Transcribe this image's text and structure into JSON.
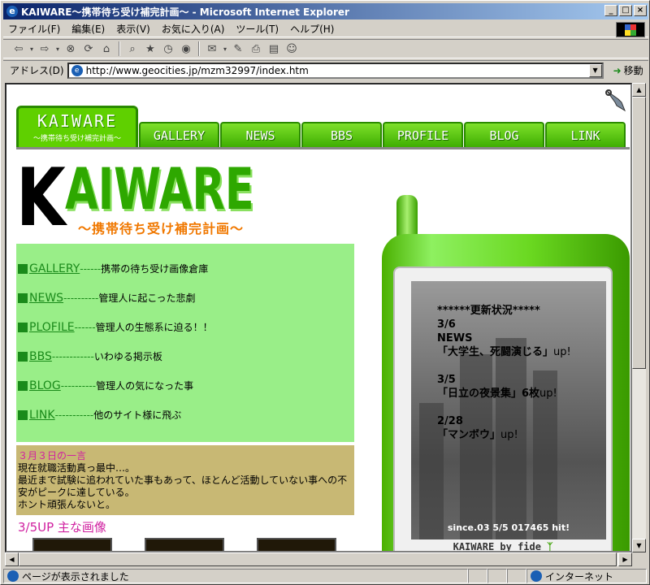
{
  "window": {
    "title": "KAIWARE〜携帯待ち受け補完計画〜 - Microsoft Internet Explorer",
    "min": "_",
    "max": "□",
    "close": "×"
  },
  "menu": [
    "ファイル(F)",
    "編集(E)",
    "表示(V)",
    "お気に入り(A)",
    "ツール(T)",
    "ヘルプ(H)"
  ],
  "toolbar_icons": [
    "back-icon",
    "forward-icon",
    "stop-icon",
    "refresh-icon",
    "home-icon",
    "search-icon",
    "favorites-icon",
    "history-icon",
    "media-icon",
    "mail-icon",
    "edit-icon",
    "print-icon",
    "discuss-icon",
    "messenger-icon"
  ],
  "address": {
    "label": "アドレス(D)",
    "url": "http://www.geocities.jp/mzm32997/index.htm",
    "go": "移動"
  },
  "page": {
    "logo_tab": {
      "big": "KAIWARE",
      "small": "〜携帯待ち受け補完計画〜"
    },
    "nav_tabs": [
      "GALLERY",
      "NEWS",
      "BBS",
      "PROFILE",
      "BLOG",
      "LINK"
    ],
    "title_k": "K",
    "title_rest": "AIWARE",
    "title_sub": "〜携帯待ち受け補完計画〜",
    "nav_links": [
      {
        "link": "GALLERY",
        "dash": "------",
        "desc": "携帯の待ち受け画像倉庫"
      },
      {
        "link": "NEWS",
        "dash": "----------",
        "desc": "管理人に起こった悲劇"
      },
      {
        "link": "PLOFILE",
        "dash": "------",
        "desc": " 管理人の生態系に迫る！！"
      },
      {
        "link": "BBS",
        "dash": "------------",
        "desc": "いわゆる掲示板"
      },
      {
        "link": "BLOG",
        "dash": "----------",
        "desc": "管理人の気になった事"
      },
      {
        "link": "LINK",
        "dash": "-----------",
        "desc": "他のサイト様に飛ぶ"
      }
    ],
    "news": {
      "head": "３月３日の一言",
      "lines": [
        "現在就職活動真っ最中…。",
        "最近まで試験に追われていた事もあって、ほとんど活動していない事への不",
        "安がピークに達している。",
        "ホント頑張んないと。"
      ]
    },
    "up_heading": "3/5UP 主な画像",
    "phone": {
      "header": "******更新状況*****",
      "updates": [
        {
          "date": "3/6",
          "title": "NEWS",
          "item": "「大学生、死闘演じる」",
          "up": "up!"
        },
        {
          "date": "3/5",
          "title": "",
          "item": "「日立の夜景集」6枚",
          "up": "up!"
        },
        {
          "date": "2/28",
          "title": "",
          "item": "「マンボウ」",
          "up": "up!"
        }
      ],
      "counter": "since.03 5/5 017465 hit!",
      "brand": "KAIWARE by fide",
      "brand_icon": "sprout-icon"
    }
  },
  "status": {
    "text": "ページが表示されました",
    "zone": "インターネット"
  },
  "colors": {
    "green": "#2ea800",
    "nav_bg": "#99ee88",
    "news_bg": "#c8b874",
    "magenta": "#d020a0",
    "orange": "#f07800"
  }
}
